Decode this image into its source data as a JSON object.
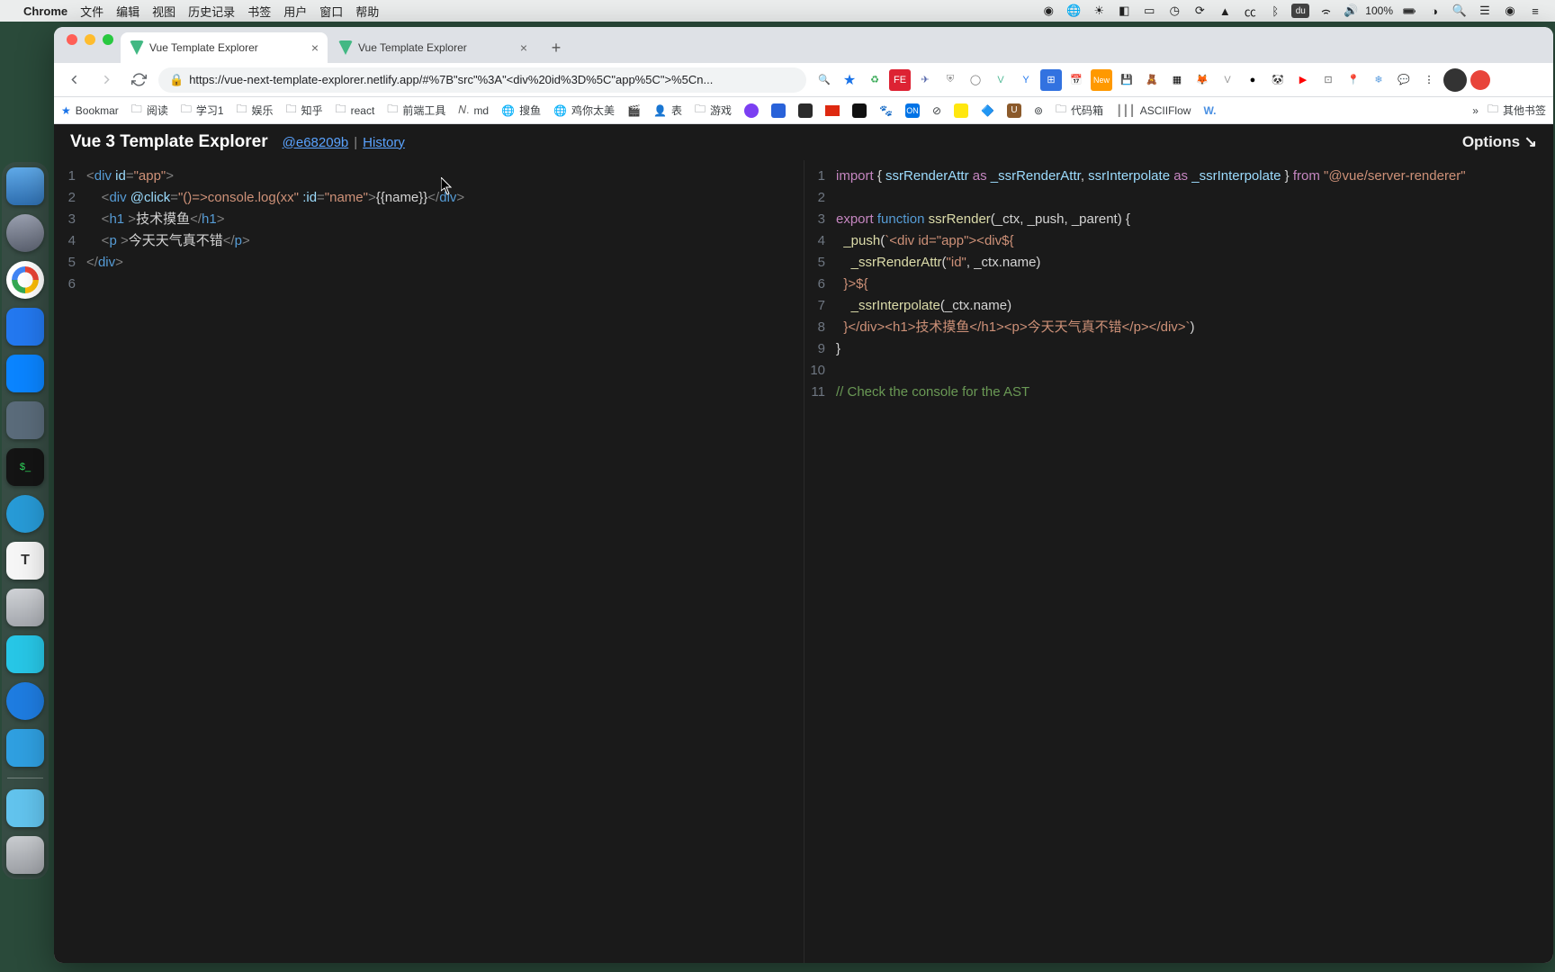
{
  "menubar": {
    "appname": "Chrome",
    "items": [
      "文件",
      "编辑",
      "视图",
      "历史记录",
      "书签",
      "用户",
      "窗口",
      "帮助"
    ],
    "battery": "100%",
    "right_icons": [
      "record-icon",
      "globe-icon",
      "sun-icon",
      "camera-icon",
      "window-icon",
      "clock-icon",
      "sync-icon",
      "triangle-icon",
      "cc-icon",
      "bluetooth-icon",
      "du-icon",
      "wifi-icon",
      "volume-icon",
      "battery-icon",
      "timer-icon",
      "search-icon",
      "control-center-icon",
      "menu-icon"
    ]
  },
  "dock": {
    "apps": [
      "Finder",
      "Launchpad",
      "Chrome",
      "Notes",
      "Xcode",
      "Preview",
      "Terminal",
      "QuickTime",
      "TextEdit",
      "Utility",
      "Cloud",
      "Hint",
      "Messenger",
      "Files"
    ],
    "trash": "Trash"
  },
  "tabs": [
    {
      "title": "Vue Template Explorer",
      "active": true
    },
    {
      "title": "Vue Template Explorer",
      "active": false
    }
  ],
  "url": {
    "scheme": "https",
    "text": "https://vue-next-template-explorer.netlify.app/#%7B\"src\"%3A\"<div%20id%3D%5C\"app%5C\">%5Cn..."
  },
  "bookmarks": {
    "first": "Bookmar",
    "items": [
      "阅读",
      "学习1",
      "娱乐",
      "知乎",
      "react",
      "前端工具",
      "md",
      "搜鱼",
      "鸡你太美",
      "",
      "表",
      "游戏"
    ],
    "right_chev": "»",
    "other": "其他书签"
  },
  "page": {
    "title": "Vue 3 Template Explorer",
    "commit": "@e68209b",
    "history": "History",
    "options": "Options ↘"
  },
  "left_editor": {
    "lines": [
      {
        "n": 1,
        "html": "<span class='tok-punct'>&lt;</span><span class='tok-tag'>div</span> <span class='tok-attr'>id</span><span class='tok-punct'>=</span><span class='tok-str'>\"app\"</span><span class='tok-punct'>&gt;</span>"
      },
      {
        "n": 2,
        "html": "    <span class='tok-punct'>&lt;</span><span class='tok-tag'>div</span> <span class='tok-attr'>@click</span><span class='tok-punct'>=</span><span class='tok-str'>\"()=&gt;console.log(xx\"</span> <span class='tok-attr'>:id</span><span class='tok-punct'>=</span><span class='tok-str'>\"name\"</span><span class='tok-punct'>&gt;</span><span class='tok-plain'>{{name}}</span><span class='tok-punct'>&lt;/</span><span class='tok-tag'>div</span><span class='tok-punct'>&gt;</span>"
      },
      {
        "n": 3,
        "html": "    <span class='tok-punct'>&lt;</span><span class='tok-tag'>h1</span> <span class='tok-punct'>&gt;</span><span class='tok-plain'>技术摸鱼</span><span class='tok-punct'>&lt;/</span><span class='tok-tag'>h1</span><span class='tok-punct'>&gt;</span>"
      },
      {
        "n": 4,
        "html": "    <span class='tok-punct'>&lt;</span><span class='tok-tag'>p</span> <span class='tok-punct'>&gt;</span><span class='tok-plain'>今天天气真不错</span><span class='tok-punct'>&lt;/</span><span class='tok-tag'>p</span><span class='tok-punct'>&gt;</span>"
      },
      {
        "n": 5,
        "html": "<span class='tok-punct'>&lt;/</span><span class='tok-tag'>div</span><span class='tok-punct'>&gt;</span>"
      },
      {
        "n": 6,
        "html": ""
      }
    ]
  },
  "right_editor": {
    "lines": [
      {
        "n": 1,
        "html": "<span class='tok-kw'>import</span> <span class='tok-plain'>{ </span><span class='tok-id'>ssrRenderAttr</span> <span class='tok-kw'>as</span> <span class='tok-id'>_ssrRenderAttr</span><span class='tok-plain'>, </span><span class='tok-id'>ssrInterpolate</span> <span class='tok-kw'>as</span> <span class='tok-id'>_ssrInterpolate</span> <span class='tok-plain'>} </span><span class='tok-kw'>from</span> <span class='tok-str'>\"@vue/server-renderer\"</span>"
      },
      {
        "n": 2,
        "html": ""
      },
      {
        "n": 3,
        "html": "<span class='tok-kw'>export</span> <span class='tok-kw2'>function</span> <span class='tok-fn'>ssrRender</span><span class='tok-plain'>(_ctx, _push, _parent) {</span>"
      },
      {
        "n": 4,
        "html": "  <span class='tok-fn'>_push</span><span class='tok-plain'>(</span><span class='tok-str'>`&lt;div id=\"app\"&gt;&lt;div${</span>"
      },
      {
        "n": 5,
        "html": "    <span class='tok-fn'>_ssrRenderAttr</span><span class='tok-plain'>(</span><span class='tok-str'>\"id\"</span><span class='tok-plain'>, _ctx.name)</span>"
      },
      {
        "n": 6,
        "html": "  <span class='tok-str'>}&gt;${</span>"
      },
      {
        "n": 7,
        "html": "    <span class='tok-fn'>_ssrInterpolate</span><span class='tok-plain'>(_ctx.name)</span>"
      },
      {
        "n": 8,
        "html": "  <span class='tok-str'>}&lt;/div&gt;&lt;h1&gt;技术摸鱼&lt;/h1&gt;&lt;p&gt;今天天气真不错&lt;/p&gt;&lt;/div&gt;`</span><span class='tok-plain'>)</span>"
      },
      {
        "n": 9,
        "html": "<span class='tok-plain'>}</span>"
      },
      {
        "n": 10,
        "html": ""
      },
      {
        "n": 11,
        "html": "<span class='tok-comment'>// Check the console for the AST</span>"
      }
    ]
  }
}
